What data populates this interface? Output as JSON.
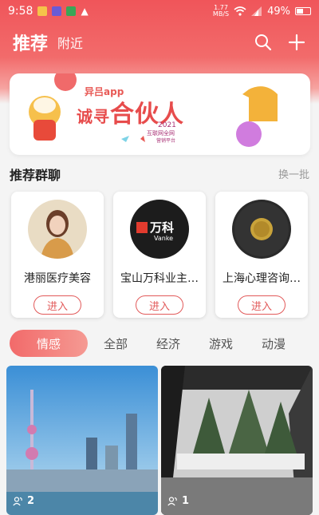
{
  "status_bar": {
    "time": "9:58",
    "net_speed": "1.77",
    "net_unit": "MB/S",
    "battery": "49%"
  },
  "header": {
    "tab_recommend": "推荐",
    "tab_nearby": "附近",
    "icons": [
      "search-icon",
      "plus-icon"
    ]
  },
  "banner": {
    "app": "异吕app",
    "headline_a": "诚寻",
    "headline_b": "合伙人",
    "year": "2021",
    "sub": "互联网全网",
    "sub2": "营销平台"
  },
  "section": {
    "title": "推荐群聊",
    "more": "换一批"
  },
  "groups": [
    {
      "name": "港丽医疗美容",
      "join": "进入"
    },
    {
      "name": "宝山万科业主…",
      "join": "进入",
      "logo_cn": "万科",
      "logo_en": "Vanke"
    },
    {
      "name": "上海心理咨询…",
      "join": "进入"
    }
  ],
  "categories": [
    "情感",
    "全部",
    "经济",
    "游戏",
    "动漫"
  ],
  "feed": [
    {
      "count": "2"
    },
    {
      "count": "1"
    }
  ],
  "colors": {
    "accent": "#f0555a",
    "join": "#e25a5a"
  }
}
